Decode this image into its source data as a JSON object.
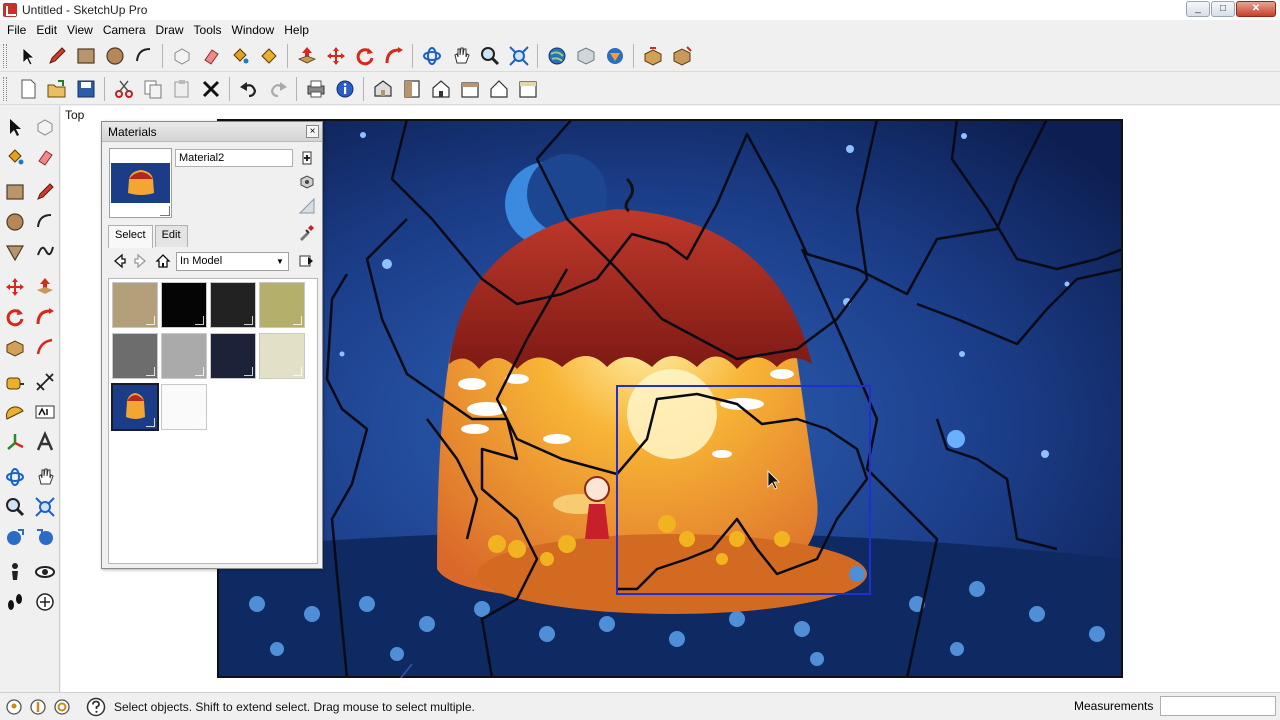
{
  "window": {
    "title": "Untitled - SketchUp Pro"
  },
  "menu": [
    "File",
    "Edit",
    "View",
    "Camera",
    "Draw",
    "Tools",
    "Window",
    "Help"
  ],
  "toolbar1": [
    "select-icon",
    "pencil-icon",
    "rectangle-icon",
    "circle-icon",
    "arc-icon",
    "make-component-icon",
    "eraser-icon",
    "paint-bucket-icon",
    "paint-bucket-alt-icon",
    "push-pull-icon",
    "move-icon",
    "rotate-icon",
    "follow-me-icon",
    "orbit-icon",
    "pan-icon",
    "zoom-icon",
    "zoom-extents-icon",
    "get-models-icon",
    "share-model-icon",
    "share-component-icon",
    "scale-icon",
    "offset-icon"
  ],
  "toolbar2": [
    "new-file-icon",
    "open-file-icon",
    "save-icon",
    "cut-icon",
    "copy-icon",
    "paste-icon",
    "erase-icon",
    "undo-icon",
    "redo-icon",
    "print-icon",
    "model-info-icon",
    "iso-view-icon",
    "top-view-icon",
    "front-view-icon",
    "right-view-icon",
    "back-view-icon",
    "left-view-icon"
  ],
  "viewport": {
    "view_name": "Top"
  },
  "materials": {
    "title": "Materials",
    "close": "×",
    "name": "Material2",
    "tabs": [
      "Select",
      "Edit"
    ],
    "collection": "In Model",
    "swatches": [
      "#b3a07a",
      "#050505",
      "#222222",
      "#b4b06c",
      "#6d6d6d",
      "#aaaaaa",
      "#1c2238",
      "#e2e0c6"
    ]
  },
  "status": {
    "message": "Select objects. Shift to extend select. Drag mouse to select multiple.",
    "measurements_label": "Measurements"
  }
}
